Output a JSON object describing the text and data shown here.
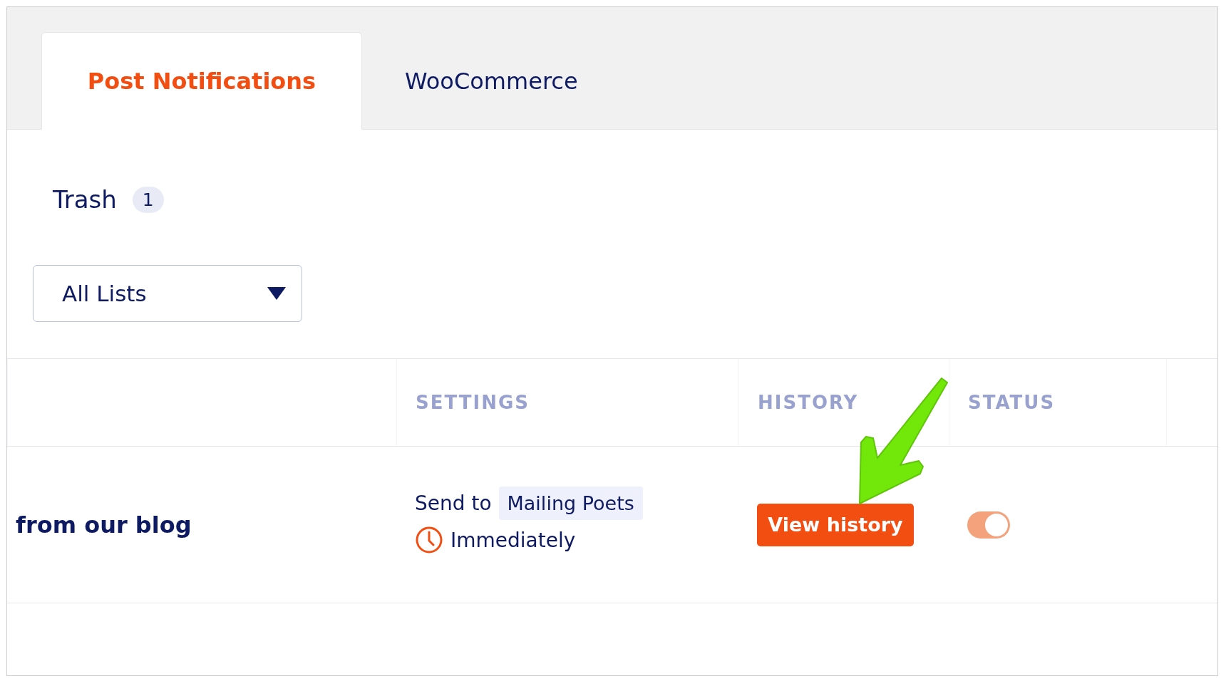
{
  "tabs": [
    {
      "label": "Post Notifications",
      "selected": true
    },
    {
      "label": "WooCommerce",
      "selected": false
    }
  ],
  "filters": {
    "trash_label": "Trash",
    "trash_count": "1",
    "list_dropdown": "All Lists"
  },
  "table": {
    "columns": [
      "SETTINGS",
      "HISTORY",
      "STATUS"
    ],
    "rows": [
      {
        "title": "from our blog",
        "send_to_label": "Send to",
        "list_tag": "Mailing Poets",
        "timing": "Immediately",
        "history_button": "View history",
        "status_on": true
      }
    ]
  }
}
